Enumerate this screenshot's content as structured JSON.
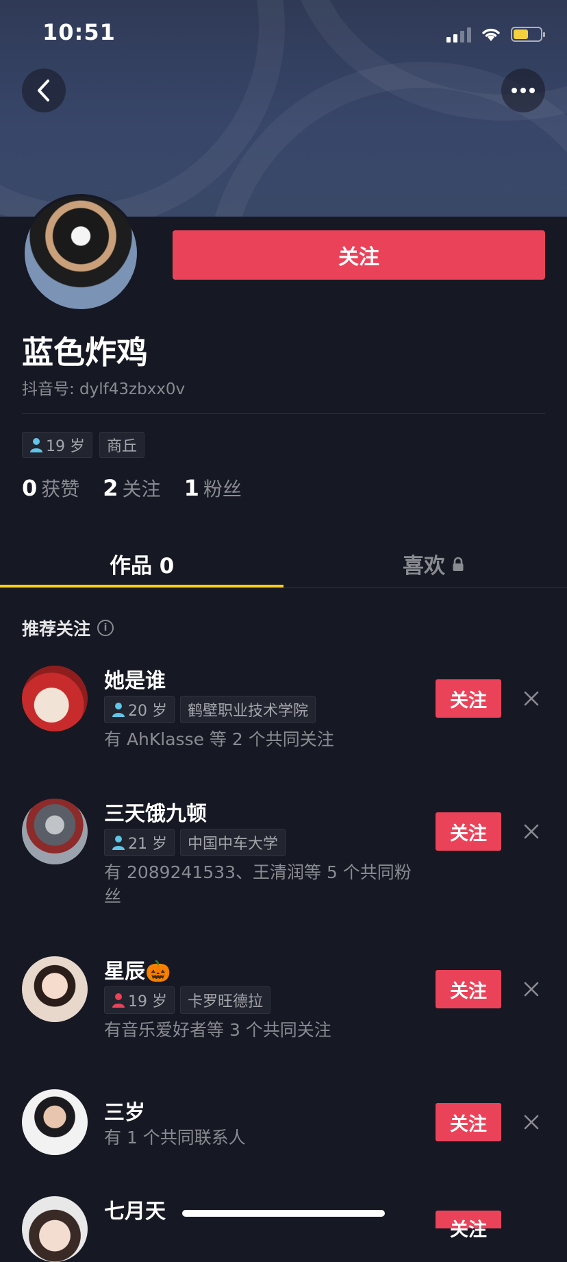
{
  "status_bar": {
    "time": "10:51",
    "battery_level": 0.55,
    "battery_color": "#f4d03f"
  },
  "header": {
    "back_icon": "chevron-left-icon",
    "more_icon": "more-horizontal-icon"
  },
  "profile": {
    "follow_label": "关注",
    "nickname": "蓝色炸鸡",
    "douyin_id": "抖音号: dylf43zbxx0v",
    "tags": [
      {
        "text": "19 岁",
        "icon": "male-icon",
        "icon_color": "#5fc6e8"
      },
      {
        "text": "商丘"
      }
    ],
    "stats": [
      {
        "num": "0",
        "label": "获赞"
      },
      {
        "num": "2",
        "label": "关注"
      },
      {
        "num": "1",
        "label": "粉丝"
      }
    ]
  },
  "tabs": {
    "works": "作品 0",
    "likes": "喜欢",
    "likes_icon": "lock-icon",
    "active_color": "#face15"
  },
  "recommend": {
    "title": "推荐关注",
    "follow_label": "关注",
    "accent": "#ea4359",
    "items": [
      {
        "name": "她是谁",
        "age": "20 岁",
        "age_icon": "male-icon",
        "school": "鹤壁职业技术学院",
        "sub": "有 AhKlasse 等 2 个共同关注"
      },
      {
        "name": "三天饿九顿",
        "age": "21 岁",
        "age_icon": "male-icon",
        "school": "中国中车大学",
        "sub": "有 2089241533、王清润等 5 个共同粉丝"
      },
      {
        "name": "星辰🎃",
        "age": "19 岁",
        "age_icon": "female-icon",
        "school": "卡罗旺德拉",
        "sub": "有音乐爱好者等 3 个共同关注"
      },
      {
        "name": "三岁",
        "sub": "有 1 个共同联系人"
      },
      {
        "name": "七月天"
      }
    ]
  }
}
